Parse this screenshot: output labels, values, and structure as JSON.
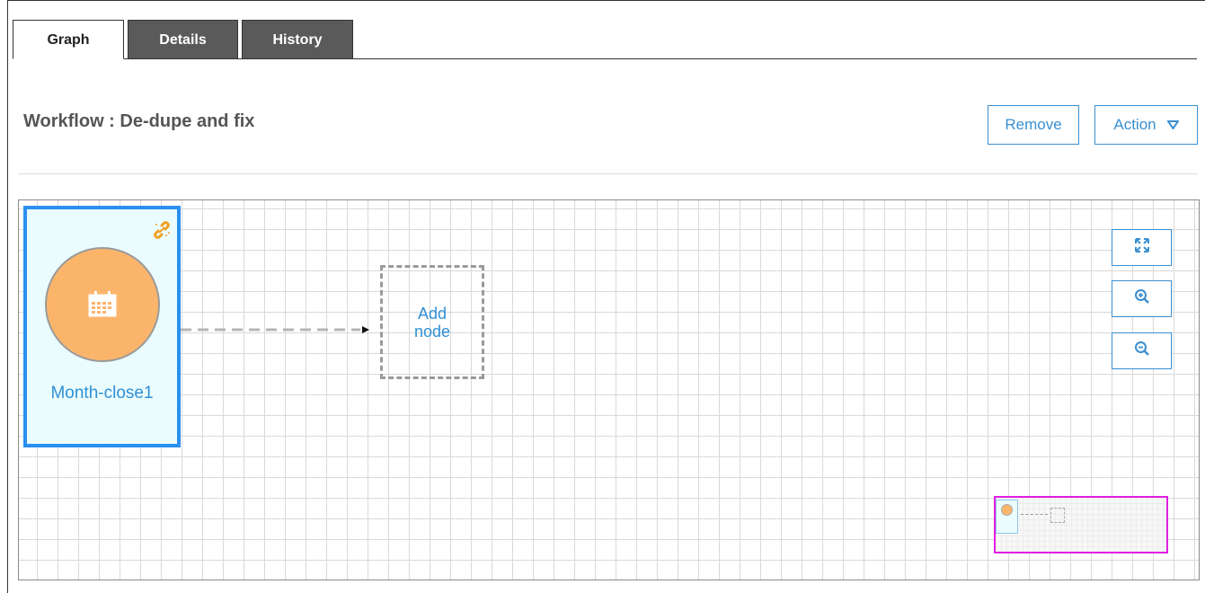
{
  "tabs": [
    {
      "label": "Graph",
      "active": true
    },
    {
      "label": "Details",
      "active": false
    },
    {
      "label": "History",
      "active": false
    }
  ],
  "header": {
    "title": "Workflow : De-dupe and fix",
    "remove_label": "Remove",
    "action_label": "Action",
    "action_icon": "triangle-down-icon"
  },
  "graph": {
    "nodes": [
      {
        "label": "Month-close1",
        "icon": "calendar-icon",
        "badge_icon": "link-icon",
        "selected": true
      }
    ],
    "add_node_label": "Add node"
  },
  "zoom_controls": [
    "fit-screen-icon",
    "zoom-in-icon",
    "zoom-out-icon"
  ],
  "colors": {
    "accent": "#3a8fd1",
    "node_fill": "#fbb56b",
    "node_bg": "#eafcfd",
    "selection": "#2b8ff0",
    "minimap_border": "#e21ee2"
  }
}
